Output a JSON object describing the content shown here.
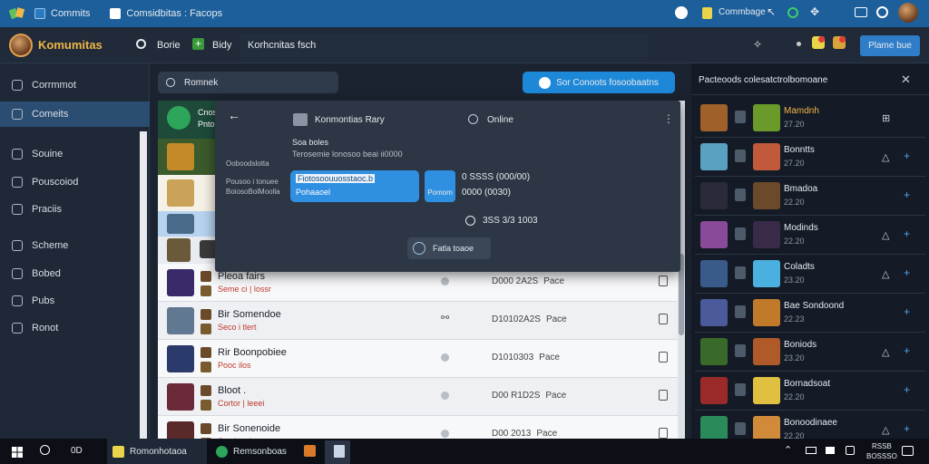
{
  "titlebar": {
    "app_title": "Commits",
    "doc_title": "Comsidbitas : Facops",
    "right_label": "Commbage"
  },
  "header": {
    "logo": "Komumitas",
    "nav": [
      "Borie",
      "Bidy",
      "Korhcnitas fsch"
    ],
    "button": "Plame bue"
  },
  "sidebar": {
    "items": [
      {
        "label": "Corrmmot"
      },
      {
        "label": "Comeits"
      },
      {
        "label": "Souine"
      },
      {
        "label": "Pouscoiod"
      },
      {
        "label": "Praciis"
      },
      {
        "label": "Scheme"
      },
      {
        "label": "Bobed"
      },
      {
        "label": "Pubs"
      },
      {
        "label": "Ronot"
      }
    ],
    "active_index": 1
  },
  "main": {
    "search_value": "Romnek",
    "cta_label": "Sor Conoots fosoobaatns",
    "header_row_text": [
      "Cnost",
      "Pnto"
    ],
    "rows": [
      {
        "name": "Pleoa fairs",
        "sub": "Seme ci | lossr",
        "date": "D000 2A2S",
        "status": "Pace",
        "icon": "dot"
      },
      {
        "name": "Bir Somendoe",
        "sub": "Seco i tlert",
        "date": "D10102A2S",
        "status": "Pace",
        "icon": "link"
      },
      {
        "name": "Rir Boonpobiee",
        "sub": "Pooc ilos",
        "date": "D1010303",
        "status": "Pace",
        "icon": "dot"
      },
      {
        "name": "Bloot  .",
        "sub": "Cortor | leeei",
        "date": "D00 R1D2S",
        "status": "Pace",
        "icon": "dot"
      },
      {
        "name": "Bir Sonenoide",
        "sub": "Sec i toel",
        "date": "D00 2013",
        "status": "Pace",
        "icon": "dot"
      }
    ]
  },
  "popup": {
    "back_icon": "arrow-left-icon",
    "contact_name": "Konmontias Rary",
    "status": "Online",
    "label_heading": "Soa boles",
    "label_sub": "Terosemie lonosoo beai ii0000",
    "left_label1": "Ooboodslotta",
    "left_label2": "Pousoo i tonuee",
    "left_label3": "BoiosoBolMoolla",
    "input_line1": "Fiotosoouuosstaoc.b",
    "input_line2": "Pohaaoel",
    "small_btn": "Pomom",
    "stat1": "0 SSSS (000/00)",
    "stat2": "0000 (0030)",
    "stat3": "3SS 3/3 1003",
    "action_button": "Fatla toaoe"
  },
  "rpanel": {
    "title": "Pacteoods colesatctrolbomoane",
    "rows": [
      {
        "name": "Mamdnh",
        "sub": "27.20",
        "name_color": "#f0b648"
      },
      {
        "name": "Bonntts",
        "sub": "27.20",
        "name_color": "#e6eaf0"
      },
      {
        "name": "Bmadoa",
        "sub": "22.20",
        "name_color": "#e6eaf0"
      },
      {
        "name": "Modinds",
        "sub": "22.20",
        "name_color": "#e6eaf0"
      },
      {
        "name": "Coladts",
        "sub": "23.20",
        "name_color": "#e6eaf0"
      },
      {
        "name": "Bae Sondoond",
        "sub": "22.23",
        "name_color": "#e6eaf0"
      },
      {
        "name": "Boniods",
        "sub": "23.20",
        "name_color": "#e6eaf0"
      },
      {
        "name": "Bornadsoat",
        "sub": "22.20",
        "name_color": "#e6eaf0"
      },
      {
        "name": "Bonoodinaee",
        "sub": "22.20",
        "name_color": "#e6eaf0"
      }
    ]
  },
  "taskbar": {
    "search_text": "0D",
    "app1": "Romonhotaoa",
    "app2": "Remsonboas",
    "clock_line1": "RSSB",
    "clock_line2": "BOSSSO"
  },
  "colors": {
    "accent": "#1e88d8",
    "titlebar": "#1c5f9a",
    "brand": "#f0b648"
  }
}
